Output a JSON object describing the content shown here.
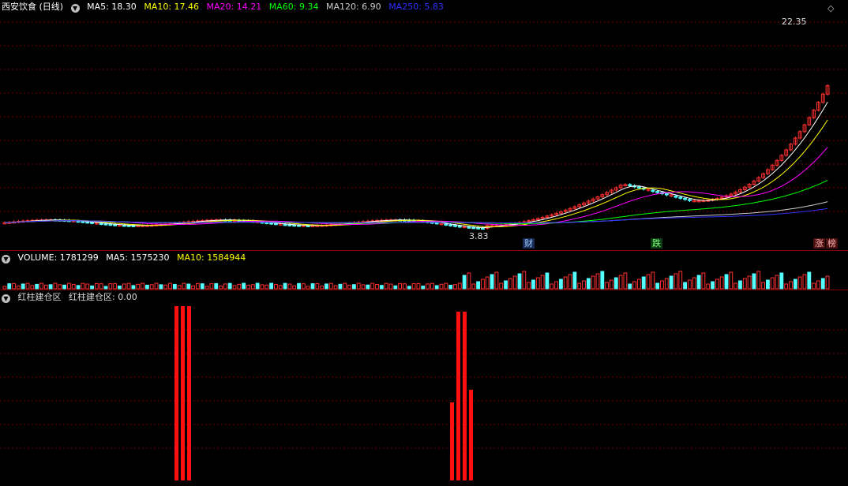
{
  "title": "西安饮食 (日线)",
  "price_legend": [
    {
      "label": "MA5: 18.30",
      "color": "#ffffff"
    },
    {
      "label": "MA10: 17.46",
      "color": "#ffff00"
    },
    {
      "label": "MA20: 14.21",
      "color": "#ff00ff"
    },
    {
      "label": "MA60: 9.34",
      "color": "#00ff00"
    },
    {
      "label": "MA120: 6.90",
      "color": "#cccccc"
    },
    {
      "label": "MA250: 5.83",
      "color": "#3030ff"
    }
  ],
  "annotations": {
    "high": "22.35",
    "low": "3.83"
  },
  "tags": {
    "fin": "财",
    "die": "跌",
    "zhang": "涨",
    "bang": "榜"
  },
  "volume_legend": [
    {
      "label": "VOLUME: 1781299",
      "color": "#ffffff"
    },
    {
      "label": "MA5: 1575230",
      "color": "#ffffff"
    },
    {
      "label": "MA10: 1584944",
      "color": "#ffff00"
    }
  ],
  "indicator_legend": [
    {
      "label": "红柱建仓区",
      "color": "#ffffff"
    },
    {
      "label": "红柱建仓区: 0.00",
      "color": "#ffffff"
    }
  ],
  "colors": {
    "up": "#ff3030",
    "down": "#54ffff",
    "grid": "#7a0000",
    "bar": "#ff1010"
  }
}
